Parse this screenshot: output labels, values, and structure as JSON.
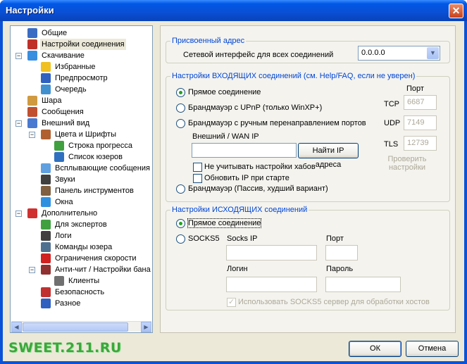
{
  "window": {
    "title": "Настройки",
    "close": "✕"
  },
  "tree": [
    {
      "label": "Общие",
      "color": "#3b6cc4"
    },
    {
      "label": "Настройки соединения",
      "color": "#c0302a",
      "selected": true
    },
    {
      "label": "Скачивание",
      "color": "#3a8ee0",
      "expand": "−"
    },
    {
      "label": "Избранные",
      "color": "#f0c020"
    },
    {
      "label": "Предпросмотр",
      "color": "#3060c0"
    },
    {
      "label": "Очередь",
      "color": "#4090d0"
    },
    {
      "label": "Шара",
      "color": "#d09a40"
    },
    {
      "label": "Сообщения",
      "color": "#c05030"
    },
    {
      "label": "Внешний вид",
      "color": "#4a7ad0",
      "expand": "−"
    },
    {
      "label": "Цвета и Шрифты",
      "color": "#b06030",
      "expand": "−"
    },
    {
      "label": "Строка прогресса",
      "color": "#40a040"
    },
    {
      "label": "Список юзеров",
      "color": "#3070c0"
    },
    {
      "label": "Всплывающие сообщения",
      "color": "#60a0e0"
    },
    {
      "label": "Звуки",
      "color": "#404040"
    },
    {
      "label": "Панель инструментов",
      "color": "#806040"
    },
    {
      "label": "Окна",
      "color": "#3090e0"
    },
    {
      "label": "Дополнительно",
      "color": "#d03030",
      "expand": "−"
    },
    {
      "label": "Для экспертов",
      "color": "#40a040"
    },
    {
      "label": "Логи",
      "color": "#404040"
    },
    {
      "label": "Команды юзера",
      "color": "#507090"
    },
    {
      "label": "Ограничения скорости",
      "color": "#d02020"
    },
    {
      "label": "Анти-чит / Настройки бана",
      "color": "#903030",
      "expand": "−"
    },
    {
      "label": "Клиенты",
      "color": "#707070"
    },
    {
      "label": "Безопасность",
      "color": "#c03030"
    },
    {
      "label": "Разное",
      "color": "#3060c0"
    }
  ],
  "assigned": {
    "legend": "Присвоенный адрес",
    "iface_label": "Сетевой интерфейс для всех соединений",
    "iface_value": "0.0.0.0",
    "dropdown_arrow": "▼"
  },
  "incoming": {
    "legend": "Настройки ВХОДЯЩИХ соединений (см. Help/FAQ, если не уверен)",
    "direct": "Прямое соединение",
    "upnp": "Брандмауэр с UPnP (только WinXP+)",
    "manual": "Брандмауэр с ручным перенаправлением портов",
    "wan_label": "Внешний / WAN IP",
    "wan_value": "",
    "find_ip": "Найти IP адреса",
    "no_hub_settings": "Не учитывать настройки хабов",
    "update_ip": "Обновить IP при старте",
    "passive": "Брандмауэр (Пассив, худший вариант)",
    "ports_label": "Порт",
    "tcp_label": "TCP",
    "tcp_value": "6687",
    "udp_label": "UDP",
    "udp_value": "7149",
    "tls_label": "TLS",
    "tls_value": "12739",
    "check_settings": "Проверить настройки"
  },
  "outgoing": {
    "legend": "Настройки ИСХОДЯЩИХ соединений",
    "direct": "Прямое соединение",
    "socks5": "SOCKS5",
    "socks_ip_label": "Socks IP",
    "port_label": "Порт",
    "login_label": "Логин",
    "password_label": "Пароль",
    "use_socks_hosts": "Использовать SOCKS5 сервер для обработки хостов"
  },
  "footer": {
    "logo": "SWEET.211.RU",
    "ok": "ОК",
    "cancel": "Отмена"
  }
}
